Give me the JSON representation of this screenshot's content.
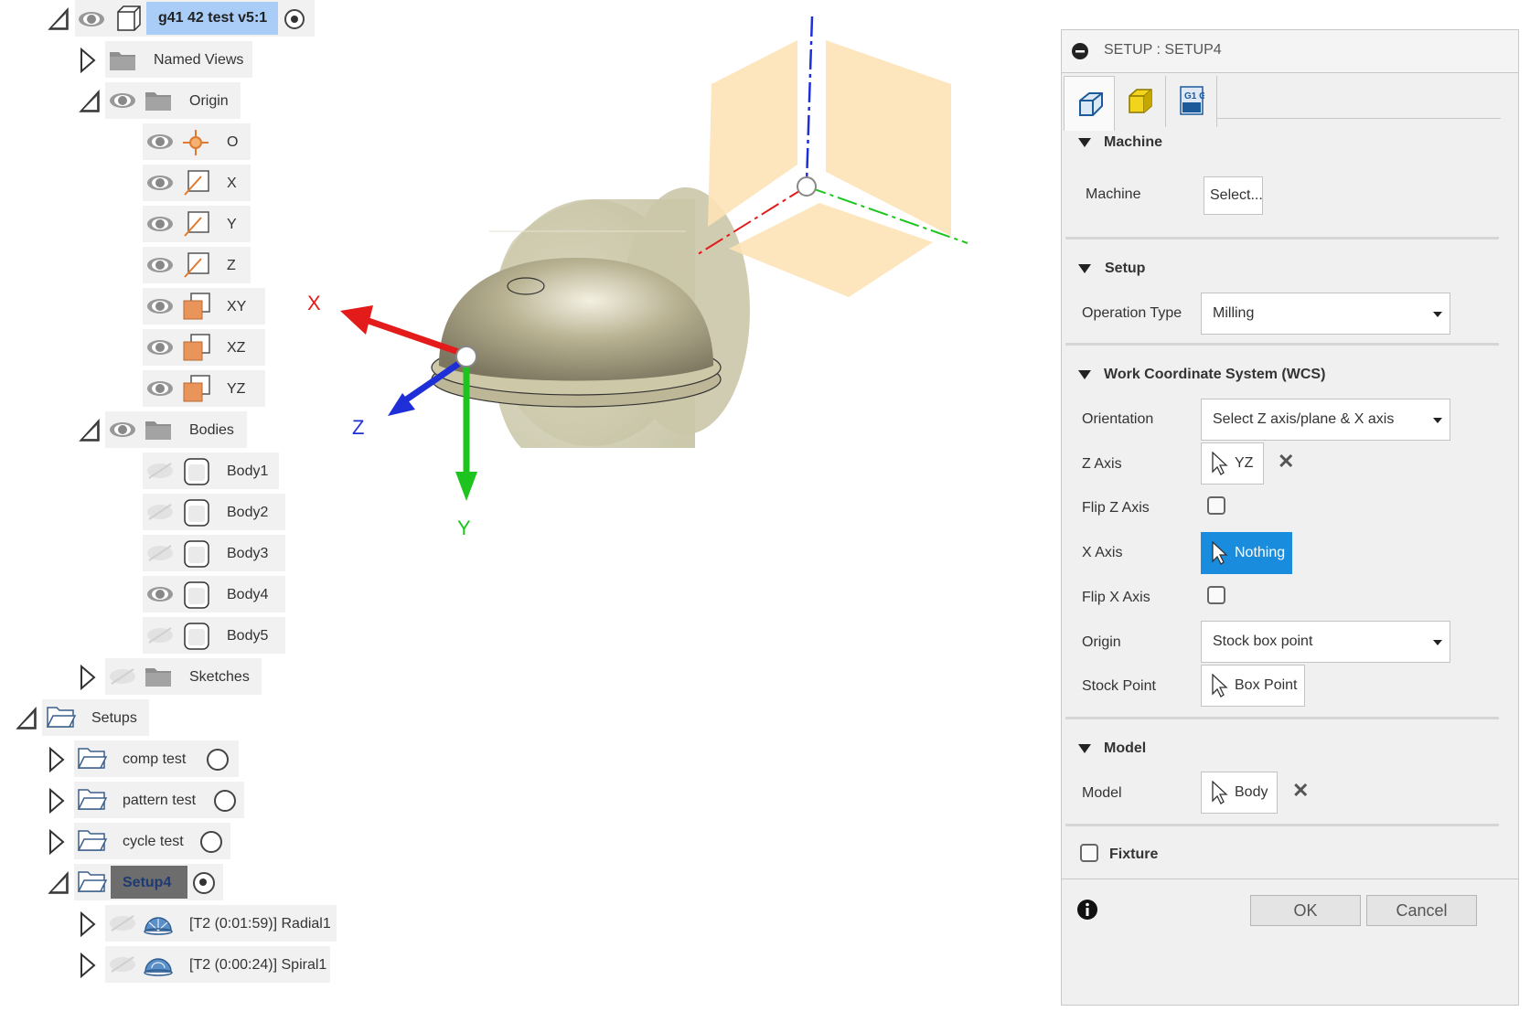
{
  "browser": {
    "root": {
      "label": "g41 42 test v5:1"
    },
    "named_views": "Named Views",
    "origin": {
      "label": "Origin",
      "items": [
        "O",
        "X",
        "Y",
        "Z",
        "XY",
        "XZ",
        "YZ"
      ]
    },
    "bodies": {
      "label": "Bodies",
      "items": [
        "Body1",
        "Body2",
        "Body3",
        "Body4",
        "Body5"
      ]
    },
    "sketches": "Sketches",
    "setups": {
      "label": "Setups",
      "items": [
        "comp test",
        "pattern test",
        "cycle test",
        "Setup4"
      ]
    },
    "operations": [
      "[T2 (0:01:59)] Radial1",
      "[T2 (0:00:24)] Spiral1"
    ]
  },
  "viewport": {
    "axis_x": "X",
    "axis_y": "Y",
    "axis_z": "Z"
  },
  "dialog": {
    "title": "SETUP : SETUP4",
    "tabs": [
      {
        "icon": "setup-icon",
        "active": true
      },
      {
        "icon": "stock-icon",
        "active": false
      },
      {
        "icon": "post-process-icon",
        "active": false,
        "text": "G1 G2"
      }
    ],
    "machine": {
      "header": "Machine",
      "label": "Machine",
      "button": "Select..."
    },
    "setup": {
      "header": "Setup",
      "operation_type_label": "Operation Type",
      "operation_type_value": "Milling"
    },
    "wcs": {
      "header": "Work Coordinate System (WCS)",
      "orientation_label": "Orientation",
      "orientation_value": "Select Z axis/plane & X axis",
      "z_axis_label": "Z Axis",
      "z_axis_value": "YZ",
      "flip_z_label": "Flip Z Axis",
      "flip_z_checked": false,
      "x_axis_label": "X Axis",
      "x_axis_value": "Nothing",
      "flip_x_label": "Flip X Axis",
      "flip_x_checked": false,
      "origin_label": "Origin",
      "origin_value": "Stock box point",
      "stock_point_label": "Stock Point",
      "stock_point_value": "Box Point"
    },
    "model": {
      "header": "Model",
      "label": "Model",
      "value": "Body"
    },
    "fixture": {
      "label": "Fixture",
      "checked": false
    },
    "ok": "OK",
    "cancel": "Cancel"
  },
  "colors": {
    "highlight_blue": "#a9cdf6",
    "active_selection": "#1a8cde",
    "setup_selected": "#6d6d6d",
    "axis_x": "#e31b1b",
    "axis_y": "#1ec41e",
    "axis_z": "#1f2fd8",
    "plane_fill": "#fde3b6"
  }
}
